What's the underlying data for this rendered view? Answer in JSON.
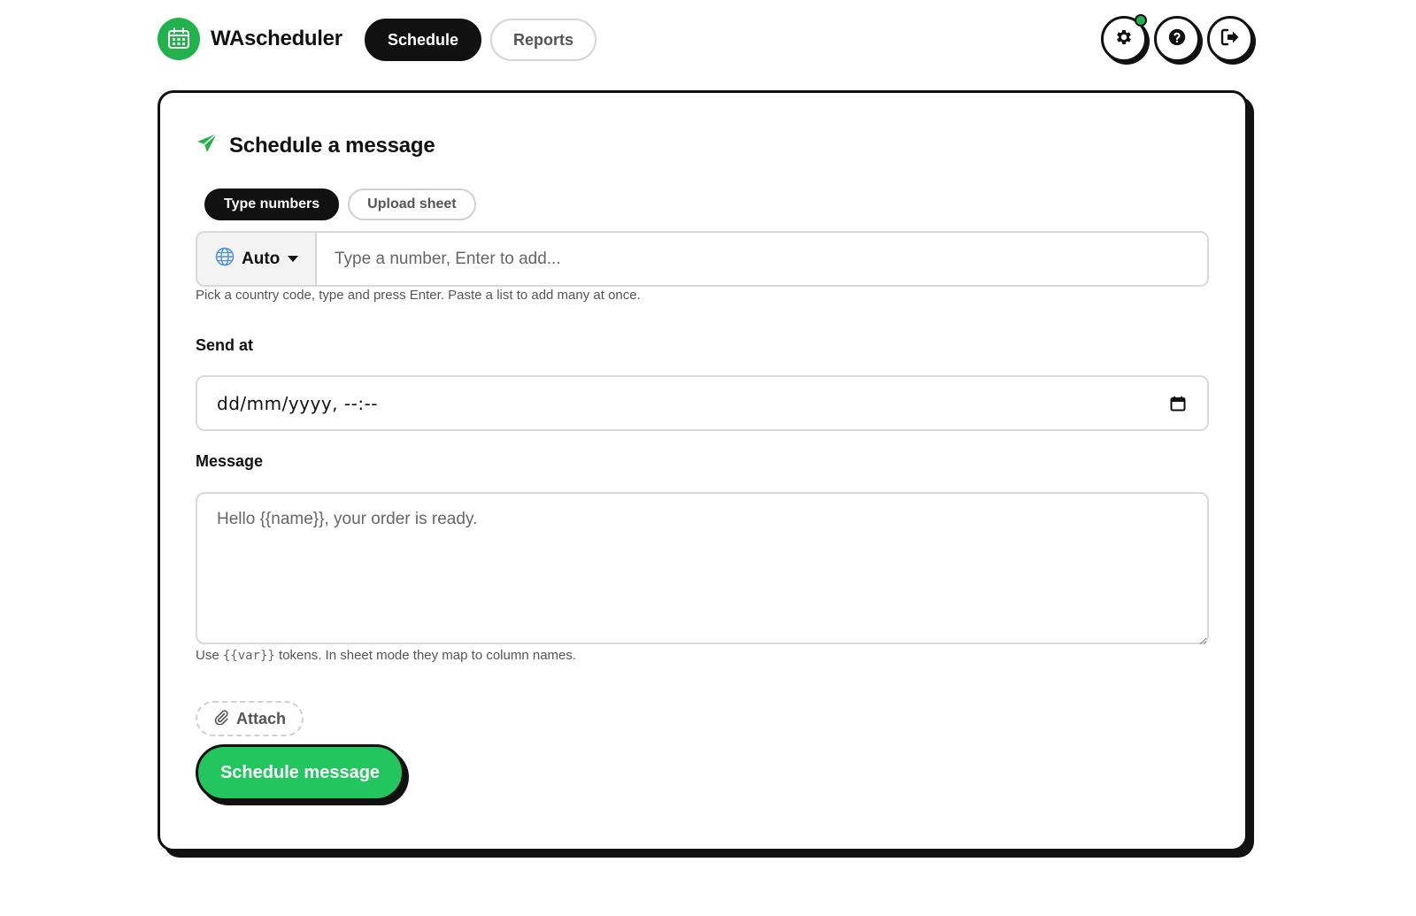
{
  "app": {
    "name": "WAscheduler",
    "accent_color": "#22b24c",
    "button_color": "#22c55e",
    "logo_icon": "calendar-icon"
  },
  "nav": {
    "tabs": [
      {
        "label": "Schedule",
        "active": true
      },
      {
        "label": "Reports",
        "active": false
      }
    ]
  },
  "header_actions": [
    {
      "icon": "gear-icon",
      "has_notification": true
    },
    {
      "icon": "help-icon",
      "has_notification": false
    },
    {
      "icon": "logout-icon",
      "has_notification": false
    }
  ],
  "form": {
    "title": "Schedule a message",
    "title_icon": "send-icon",
    "mode_tabs": [
      {
        "label": "Type numbers",
        "active": true
      },
      {
        "label": "Upload sheet",
        "active": false
      }
    ],
    "country": {
      "selected": "Auto",
      "icon": "globe-icon"
    },
    "numbers_input": {
      "placeholder": "Type a number, Enter to add...",
      "value": ""
    },
    "numbers_hint": "Pick a country code, type and press Enter. Paste a list to add many at once.",
    "send_at": {
      "label": "Send at",
      "value": "dd/mm/yyyy, --:--"
    },
    "message": {
      "label": "Message",
      "placeholder": "Hello {{name}}, your order is ready.",
      "value": ""
    },
    "message_hint": {
      "prefix": "Use ",
      "token": "{{var}}",
      "suffix": " tokens. In sheet mode they map to column names."
    },
    "attach_label": "Attach",
    "submit_label": "Schedule message"
  }
}
